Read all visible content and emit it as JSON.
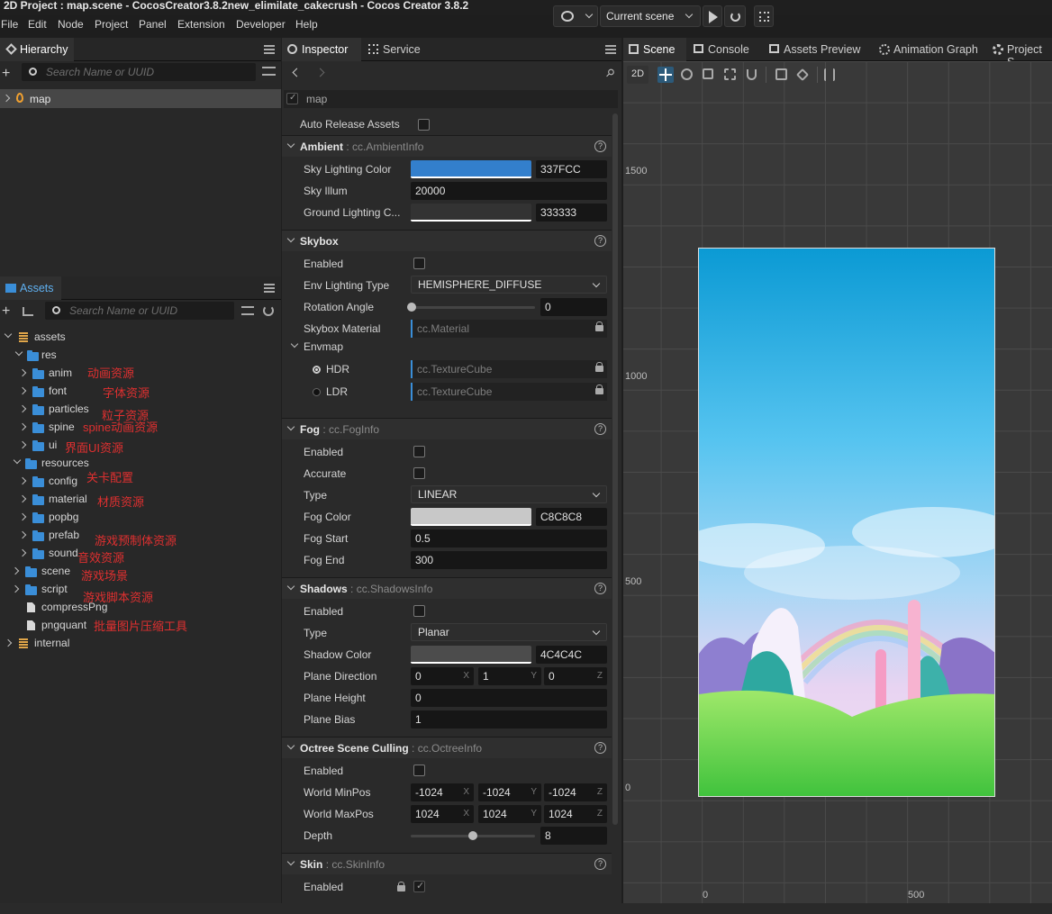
{
  "window": {
    "title": "2D Project : map.scene - CocosCreator3.8.2new_elimilate_cakecrush - Cocos Creator 3.8.2"
  },
  "menu": [
    "File",
    "Edit",
    "Node",
    "Project",
    "Panel",
    "Extension",
    "Developer",
    "Help"
  ],
  "toolbar": {
    "scene_select": "Current scene"
  },
  "hierarchy": {
    "tab": "Hierarchy",
    "search_placeholder": "Search Name or UUID",
    "root": "map"
  },
  "assets": {
    "tab": "Assets",
    "search_placeholder": "Search Name or UUID",
    "tree": [
      {
        "label": "assets"
      },
      {
        "label": "res"
      },
      {
        "label": "anim",
        "note": "动画资源"
      },
      {
        "label": "font",
        "note": "字体资源"
      },
      {
        "label": "particles",
        "note": "粒子资源"
      },
      {
        "label": "spine",
        "note": "spine动画资源"
      },
      {
        "label": "ui",
        "note": "界面UI资源"
      },
      {
        "label": "resources"
      },
      {
        "label": "config",
        "note": "关卡配置"
      },
      {
        "label": "material",
        "note": "材质资源"
      },
      {
        "label": "popbg"
      },
      {
        "label": "prefab",
        "note": "游戏预制体资源"
      },
      {
        "label": "sound",
        "note": "音效资源"
      },
      {
        "label": "scene",
        "note": "游戏场景"
      },
      {
        "label": "script",
        "note": "游戏脚本资源"
      },
      {
        "label": "compressPng"
      },
      {
        "label": "pngquant",
        "note": "批量图片压缩工具"
      },
      {
        "label": "internal"
      }
    ]
  },
  "inspector": {
    "tabs": [
      "Inspector",
      "Service"
    ],
    "node_name": "map",
    "auto_release": "Auto Release Assets",
    "ambient": {
      "title": "Ambient",
      "type": ": cc.AmbientInfo",
      "sky_color_label": "Sky Lighting Color",
      "sky_color_hex": "337FCC",
      "sky_color": "#337FCC",
      "sky_illum_label": "Sky Illum",
      "sky_illum": "20000",
      "ground_label": "Ground Lighting C...",
      "ground_hex": "333333",
      "ground_color": "#333333"
    },
    "skybox": {
      "title": "Skybox",
      "enabled_label": "Enabled",
      "env_type_label": "Env Lighting Type",
      "env_type": "HEMISPHERE_DIFFUSE",
      "rotation_label": "Rotation Angle",
      "rotation": "0",
      "rotation_level": 0,
      "material_label": "Skybox Material",
      "material": "cc.Material",
      "envmap_label": "Envmap",
      "hdr_label": "HDR",
      "hdr": "cc.TextureCube",
      "ldr_label": "LDR",
      "ldr": "cc.TextureCube"
    },
    "fog": {
      "title": "Fog",
      "type": ": cc.FogInfo",
      "enabled_label": "Enabled",
      "accurate_label": "Accurate",
      "type_label": "Type",
      "fog_type": "LINEAR",
      "color_label": "Fog Color",
      "color_hex": "C8C8C8",
      "color": "#C8C8C8",
      "start_label": "Fog Start",
      "start": "0.5",
      "end_label": "Fog End",
      "end": "300"
    },
    "shadows": {
      "title": "Shadows",
      "type": ": cc.ShadowsInfo",
      "enabled_label": "Enabled",
      "type_label": "Type",
      "shadow_type": "Planar",
      "color_label": "Shadow Color",
      "color_hex": "4C4C4C",
      "color": "#4C4C4C",
      "dir_label": "Plane Direction",
      "dir_x": "0",
      "dir_y": "1",
      "dir_z": "0",
      "height_label": "Plane Height",
      "height": "0",
      "bias_label": "Plane Bias",
      "bias": "1"
    },
    "octree": {
      "title": "Octree Scene Culling",
      "type": ": cc.OctreeInfo",
      "enabled_label": "Enabled",
      "min_label": "World MinPos",
      "min_x": "-1024",
      "min_y": "-1024",
      "min_z": "-1024",
      "max_label": "World MaxPos",
      "max_x": "1024",
      "max_y": "1024",
      "max_z": "1024",
      "depth_label": "Depth",
      "depth": "8",
      "depth_level": 0.5
    },
    "skin": {
      "title": "Skin",
      "type": ": cc.SkinInfo",
      "enabled_label": "Enabled"
    },
    "axes": {
      "x": "X",
      "y": "Y",
      "z": "Z"
    }
  },
  "scene_tabs": [
    "Scene",
    "Console",
    "Assets Preview",
    "Animation Graph",
    "Project S"
  ],
  "scene": {
    "mode_2d": "2D",
    "y_labels": [
      "1500",
      "1000",
      "500",
      "0"
    ],
    "x_labels": [
      "0",
      "500"
    ]
  }
}
